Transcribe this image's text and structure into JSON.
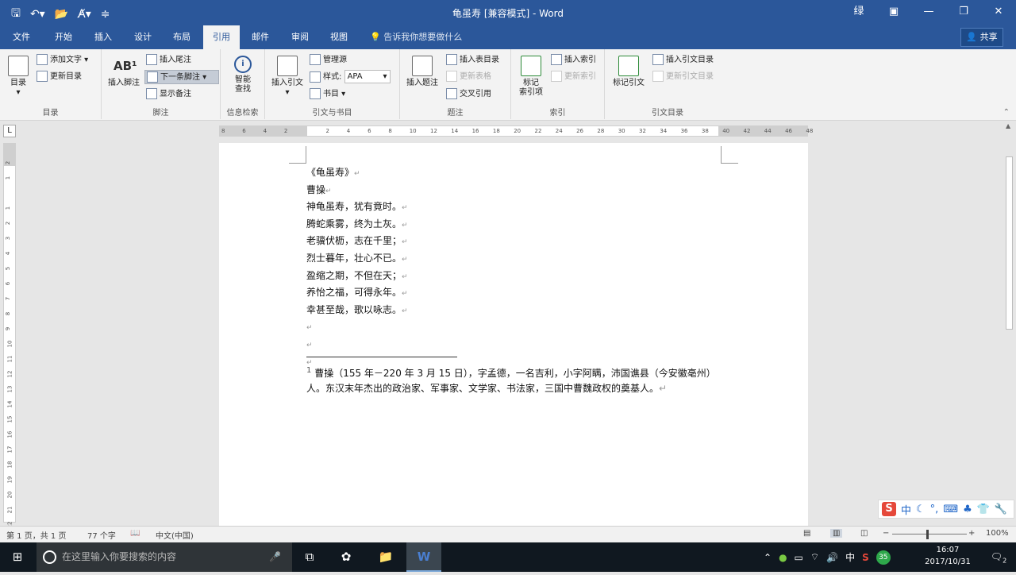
{
  "titlebar": {
    "title": "龟虽寿 [兼容模式] - Word",
    "user_initial": "绿",
    "qat": [
      "save-icon",
      "undo-icon",
      "open-icon",
      "format-painter-icon",
      "customize-icon"
    ]
  },
  "tabs": [
    "文件",
    "开始",
    "插入",
    "设计",
    "布局",
    "引用",
    "邮件",
    "审阅",
    "视图"
  ],
  "active_tab": "引用",
  "tellme": "告诉我你想要做什么",
  "share": "共享",
  "ribbon": {
    "toc": {
      "big": "目录",
      "add_text": "添加文字",
      "update": "更新目录",
      "label": "目录"
    },
    "footnote": {
      "big": "插入脚注",
      "endnote": "插入尾注",
      "next": "下一条脚注",
      "show": "显示备注",
      "label": "脚注"
    },
    "research": {
      "big1": "智能",
      "big2": "查找",
      "label": "信息检索"
    },
    "citation": {
      "big": "插入引文",
      "manage": "管理源",
      "style_label": "样式:",
      "style_value": "APA",
      "bib": "书目",
      "label": "引文与书目"
    },
    "caption": {
      "big": "插入题注",
      "table_of_figures": "插入表目录",
      "update_table": "更新表格",
      "cross_ref": "交叉引用",
      "label": "题注"
    },
    "index": {
      "big1": "标记",
      "big2": "索引项",
      "insert": "插入索引",
      "update": "更新索引",
      "label": "索引"
    },
    "toa": {
      "big": "标记引文",
      "insert": "插入引文目录",
      "update": "更新引文目录",
      "label": "引文目录"
    }
  },
  "hruler_ticks": [
    "8",
    "6",
    "4",
    "2",
    "",
    "2",
    "4",
    "6",
    "8",
    "10",
    "12",
    "14",
    "16",
    "18",
    "20",
    "22",
    "24",
    "26",
    "28",
    "30",
    "32",
    "34",
    "36",
    "38",
    "40",
    "42",
    "44",
    "46",
    "48"
  ],
  "vruler_ticks": [
    "2",
    "1",
    "",
    "1",
    "2",
    "3",
    "4",
    "5",
    "6",
    "7",
    "8",
    "9",
    "10",
    "11",
    "12",
    "13",
    "14",
    "15",
    "16",
    "17",
    "18",
    "19",
    "20",
    "21",
    "22"
  ],
  "document": {
    "lines": [
      "《龟虽寿》",
      "曹操",
      "神龟虽寿，犹有竟时。",
      "腾蛇乘雾，终为土灰。",
      "老骥伏枥，志在千里；",
      "烈士暮年，壮心不已。",
      "盈缩之期，不但在天；",
      "养怡之福，可得永年。",
      "幸甚至哉，歌以咏志。",
      "",
      "",
      ""
    ],
    "footnote_mark": "1",
    "footnote": "曹操（155 年－220 年 3 月 15 日），字孟德，一名吉利，小字阿瞒，沛国谯县（今安徽亳州）人。东汉末年杰出的政治家、军事家、文学家、书法家，三国中曹魏政权的奠基人。",
    "mark": "↵"
  },
  "status": {
    "page": "第 1 页，共 1 页",
    "words": "77 个字",
    "lang": "中文(中国)",
    "zoom": "100%"
  },
  "taskbar": {
    "search_placeholder": "在这里输入你要搜索的内容",
    "time": "16:07",
    "date": "2017/10/31",
    "ime": "中",
    "badge": "35",
    "notif": "2"
  }
}
